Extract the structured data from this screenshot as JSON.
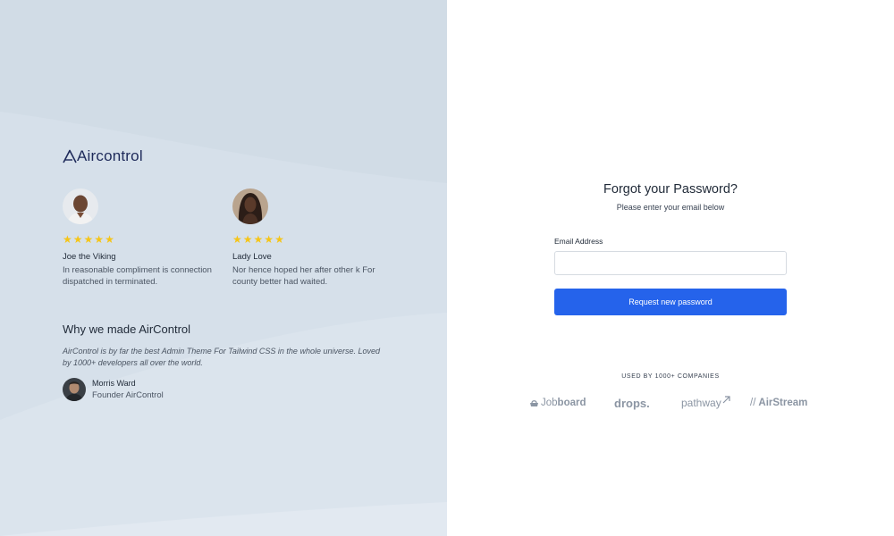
{
  "brand": {
    "logo_text": "Aircontrol"
  },
  "testimonials": [
    {
      "name": "Joe the Viking",
      "rating": 5,
      "stars": "★★★★★",
      "quote": "In reasonable compliment is connection dispatched in terminated."
    },
    {
      "name": "Lady Love",
      "rating": 5,
      "stars": "★★★★★",
      "quote": "Nor hence hoped her after other k For county better had waited."
    }
  ],
  "why": {
    "title": "Why we made AirControl",
    "text": "AirControl is by far the best Admin Theme For Tailwind CSS in the whole universe. Loved by 1000+ developers all over the world.",
    "author_name": "Morris Ward",
    "author_role": "Founder AirControl"
  },
  "form": {
    "title": "Forgot your Password?",
    "subtitle": "Please enter your email below",
    "email_label": "Email Address",
    "email_value": "",
    "email_placeholder": "",
    "submit_label": "Request new password"
  },
  "companies": {
    "title": "USED BY 1000+ COMPANIES",
    "logos": [
      "Jobboard",
      "drops.",
      "pathway",
      "// AirStream"
    ]
  },
  "colors": {
    "left_bg": "#d1dce6",
    "primary": "#2563eb",
    "star": "#f5c518",
    "brand_logo": "#1e2a5a",
    "company_logo": "#8b95a3"
  }
}
